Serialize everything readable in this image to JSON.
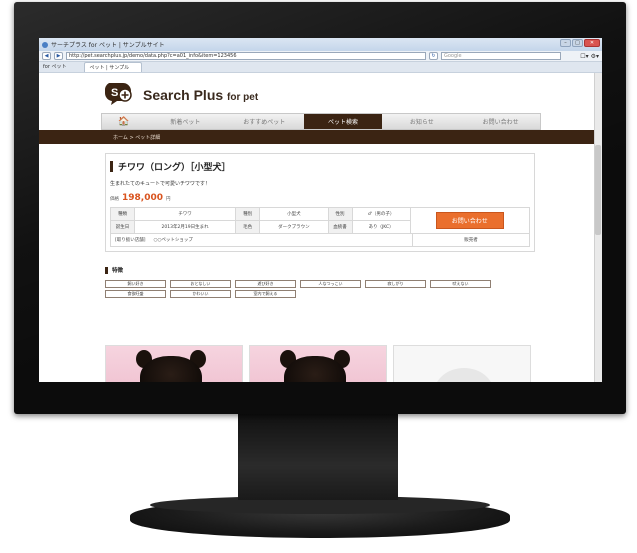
{
  "browser": {
    "window_title": "サーチプラス for ペット | サンプルサイト",
    "url": "http://pet.searchplus.jp/demo/data.php?c=a01_info&item=123456",
    "search_placeholder": "Google",
    "favorites_label": "for ペット",
    "tab_label": "ペット | サンプル",
    "back_glyph": "◀",
    "forward_glyph": "▶",
    "refresh_glyph": "↻",
    "tools_label": "☐▾ ⚙▾",
    "minimize_glyph": "–",
    "maximize_glyph": "□",
    "close_glyph": "✕"
  },
  "site": {
    "logo_icon": "search-plus-logo",
    "name": "Search Plus",
    "name_suffix": "for pet",
    "brand_color": "#3b2413",
    "accent_color": "#ea6f2d"
  },
  "nav": {
    "home_icon": "🏠",
    "items": [
      "新着ペット",
      "おすすめペット",
      "ペット検索",
      "お知らせ",
      "お問い合わせ"
    ],
    "active_index": 2
  },
  "breadcrumb": "ホーム > ペット詳細",
  "detail": {
    "title": "チワワ（ロング）［小型犬］",
    "catch": "生まれたてのキュートで可愛いチワワです！",
    "price_label": "価格",
    "price": "198,000",
    "price_unit": "円",
    "specs": [
      [
        "種類",
        "チワワ",
        "種別",
        "小型犬",
        "性別",
        "♂（男の子）"
      ],
      [
        "誕生日",
        "2013年2月19日生まれ",
        "毛色",
        "ダークブラウン",
        "血統書",
        "あり（JKC）"
      ]
    ],
    "cta_label": "お問い合わせ",
    "shop_label": "[取り扱い店舗]",
    "shop_name": "○○ペットショップ",
    "shop_extra": "販売者"
  },
  "features": {
    "heading": "特徴",
    "tags": [
      "飼い好き",
      "おとなしい",
      "遊び好き",
      "人なつっこい",
      "寂しがり",
      "吠えない",
      "食欲旺盛",
      "かわいい",
      "室内で飼える"
    ]
  },
  "photos": [
    {
      "kind": "dog-photo"
    },
    {
      "kind": "dog-photo"
    },
    {
      "kind": "no-image-placeholder"
    }
  ]
}
